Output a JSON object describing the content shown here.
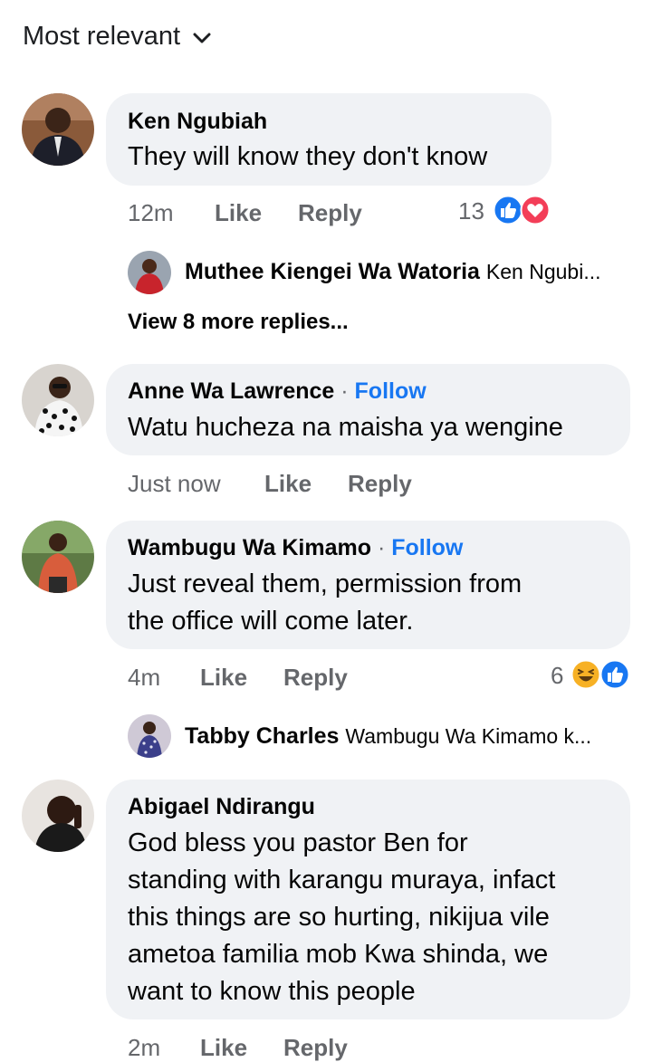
{
  "sort": {
    "label": "Most relevant"
  },
  "comments": [
    {
      "author": "Ken Ngubiah",
      "text": "They will know they don't know",
      "time": "12m",
      "like": "Like",
      "reply": "Reply",
      "reaction_count": "13",
      "reactions": [
        "like-icon",
        "love-icon"
      ],
      "reply_preview": {
        "author": "Muthee Kiengei Wa Watoria",
        "snippet": "Ken Ngubi..."
      },
      "more_replies": "View 8 more replies..."
    },
    {
      "author": "Anne Wa Lawrence",
      "follow_sep": "·",
      "follow": "Follow",
      "text": "Watu hucheza na maisha ya wengine",
      "time": "Just now",
      "like": "Like",
      "reply": "Reply"
    },
    {
      "author": "Wambugu Wa Kimamo",
      "follow_sep": "·",
      "follow": "Follow",
      "text_lines": [
        "Just reveal them, permission from",
        "the office will come later."
      ],
      "time": "4m",
      "like": "Like",
      "reply": "Reply",
      "reaction_count": "6",
      "reactions": [
        "haha-icon",
        "like-icon"
      ],
      "reply_preview": {
        "author": "Tabby Charles",
        "snippet": "Wambugu Wa Kimamo k..."
      }
    },
    {
      "author": "Abigael Ndirangu",
      "text_lines": [
        "God bless you pastor Ben for",
        "standing with karangu muraya, infact",
        "this things are so hurting, nikijua vile",
        "ametoa familia mob Kwa shinda, we",
        "want to know this people"
      ],
      "time": "2m",
      "like": "Like",
      "reply": "Reply"
    }
  ],
  "colors": {
    "bubble": "#f0f2f5",
    "link": "#1877f2",
    "meta": "#65676b",
    "love": "#f33e58",
    "haha": "#f7b125"
  }
}
